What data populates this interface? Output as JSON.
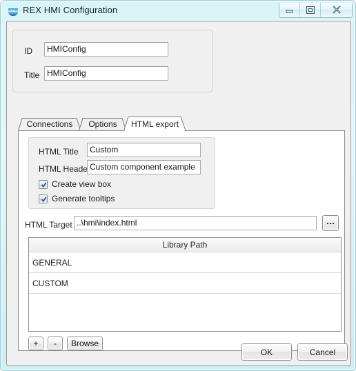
{
  "window": {
    "title": "REX HMI Configuration",
    "icon": "rex-crown-icon",
    "controls": {
      "minimize": "minimize-button",
      "restore": "restore-button",
      "close": "close-button"
    }
  },
  "header_group": {
    "fields": [
      {
        "label": "ID",
        "value": "HMIConfig"
      },
      {
        "label": "Title",
        "value": "HMIConfig"
      }
    ]
  },
  "tabs": [
    {
      "label": "Connections",
      "active": false
    },
    {
      "label": "Options",
      "active": false
    },
    {
      "label": "HTML export",
      "active": true
    }
  ],
  "html_export": {
    "group": {
      "fields": [
        {
          "label": "HTML Title",
          "value": "Custom"
        },
        {
          "label": "HTML Header",
          "value": "Custom component example"
        }
      ],
      "checkboxes": [
        {
          "label": "Create view box",
          "checked": true
        },
        {
          "label": "Generate tooltips",
          "checked": true
        }
      ]
    },
    "target": {
      "label": "HTML Target",
      "value": "..\\hmi\\index.html",
      "browse_label": "..."
    },
    "library": {
      "header": "Library Path",
      "rows": [
        "GENERAL",
        "CUSTOM"
      ],
      "buttons": [
        {
          "label": "+",
          "name": "add-library-button"
        },
        {
          "label": "-",
          "name": "remove-library-button"
        },
        {
          "label": "Browse",
          "name": "browse-library-button"
        }
      ]
    }
  },
  "dialog_buttons": {
    "ok": "OK",
    "cancel": "Cancel"
  },
  "colors": {
    "frame": "#d9f4f7",
    "client": "#f0f0f0",
    "check": "#2a5aa8",
    "icon": "#2f86c8"
  }
}
